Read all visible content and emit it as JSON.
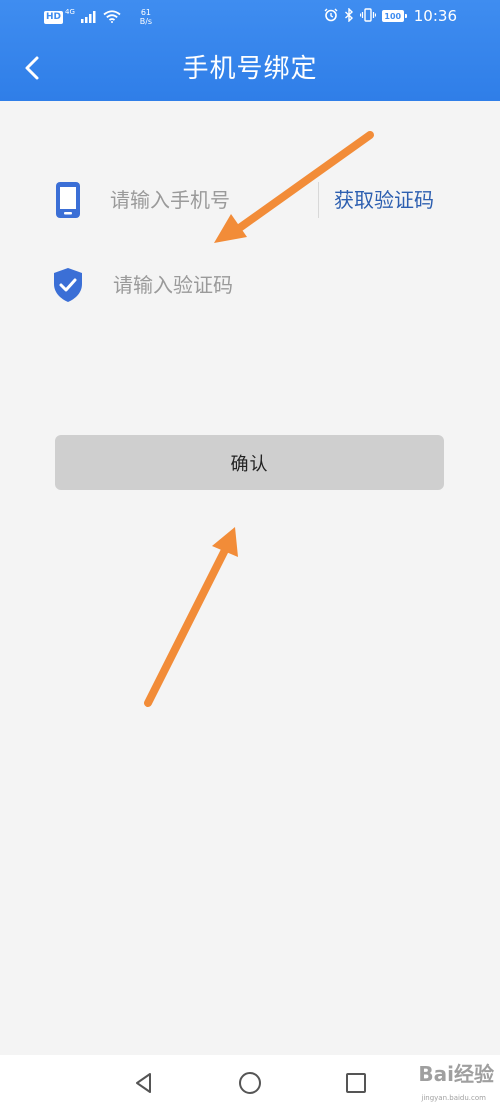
{
  "status_bar": {
    "network_badge": "HD",
    "network_type": "4G",
    "speed_value": "61",
    "speed_unit": "B/s",
    "battery": "100",
    "time": "10:36",
    "icons": [
      "alarm-icon",
      "bluetooth-icon",
      "vibrate-icon",
      "battery-icon"
    ]
  },
  "header": {
    "title": "手机号绑定",
    "back_icon": "chevron-left-icon"
  },
  "form": {
    "phone": {
      "icon": "phone-icon",
      "value": "",
      "placeholder": "请输入手机号"
    },
    "get_code_label": "获取验证码",
    "code": {
      "icon": "shield-check-icon",
      "value": "",
      "placeholder": "请输入验证码"
    },
    "confirm_label": "确认"
  },
  "bottom_nav": {
    "items": [
      "back-triangle-icon",
      "home-circle-icon",
      "recent-square-icon"
    ]
  },
  "watermark": {
    "main": "Bai经验",
    "sub": "jingyan.baidu.com"
  },
  "colors": {
    "header_bg": "#3f8df0",
    "accent": "#2d5fb0",
    "icon_blue": "#3b6fd6",
    "page_bg": "#f4f4f4",
    "button_bg": "#cfcfcf",
    "arrow": "#f28c38"
  }
}
